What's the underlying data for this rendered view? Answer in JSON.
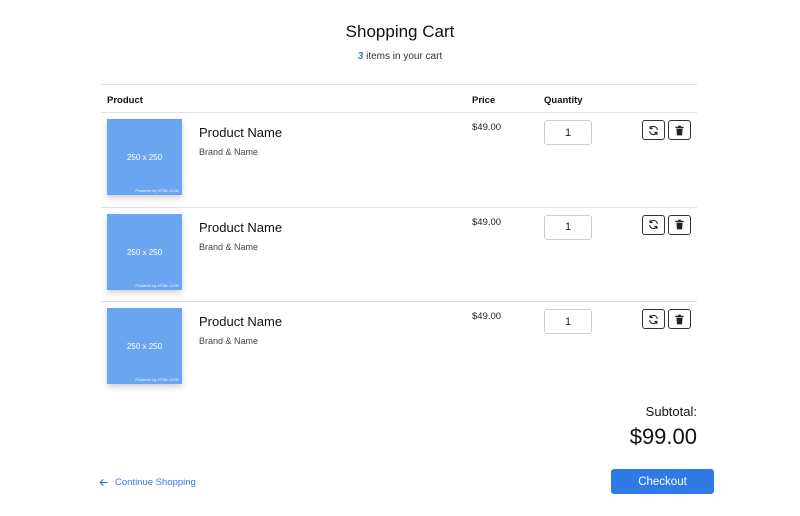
{
  "header": {
    "title": "Shopping Cart",
    "item_count": "3",
    "item_count_suffix": "items in your cart"
  },
  "table": {
    "columns": {
      "product": "Product",
      "price": "Price",
      "quantity": "Quantity"
    },
    "rows": [
      {
        "thumb_size": "250 x 250",
        "thumb_credit": "Powered by HTML.COM",
        "name": "Product Name",
        "brand": "Brand & Name",
        "price": "$49.00",
        "quantity": "1"
      },
      {
        "thumb_size": "250 x 250",
        "thumb_credit": "Powered by HTML.COM",
        "name": "Product Name",
        "brand": "Brand & Name",
        "price": "$49.00",
        "quantity": "1"
      },
      {
        "thumb_size": "250 x 250",
        "thumb_credit": "Powered by HTML.COM",
        "name": "Product Name",
        "brand": "Brand & Name",
        "price": "$49.00",
        "quantity": "1"
      }
    ],
    "row_icons": [
      "refresh-icon",
      "trash-icon"
    ]
  },
  "summary": {
    "subtotal_label": "Subtotal:",
    "subtotal_value": "$99.00"
  },
  "footer": {
    "continue_label": "Continue Shopping",
    "continue_icon": "arrow-left-icon",
    "checkout_label": "Checkout"
  },
  "colors": {
    "accent": "#2f7ae5",
    "thumb": "#6aa5f0"
  }
}
